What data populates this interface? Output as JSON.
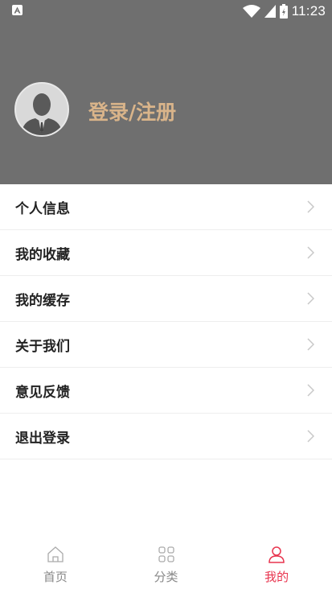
{
  "status_bar": {
    "time": "11:23"
  },
  "profile": {
    "login_label": "登录/注册"
  },
  "menu": {
    "items": [
      {
        "label": "个人信息"
      },
      {
        "label": "我的收藏"
      },
      {
        "label": "我的缓存"
      },
      {
        "label": "关于我们"
      },
      {
        "label": "意见反馈"
      },
      {
        "label": "退出登录"
      }
    ]
  },
  "tabs": [
    {
      "label": "首页",
      "icon": "home-icon",
      "active": false
    },
    {
      "label": "分类",
      "icon": "grid-icon",
      "active": false
    },
    {
      "label": "我的",
      "icon": "user-icon",
      "active": true
    }
  ],
  "colors": {
    "header_bg": "#6f6f6f",
    "login_text": "#d9b48a",
    "active_tab": "#e8344e",
    "inactive_tab": "#888888"
  }
}
